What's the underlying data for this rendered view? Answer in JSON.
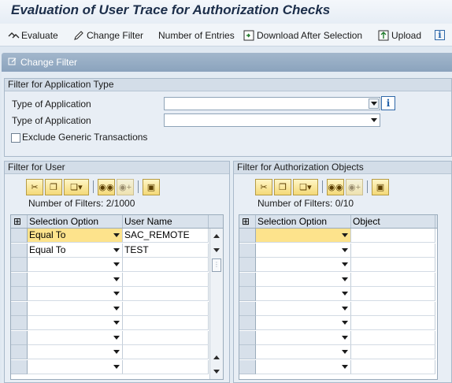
{
  "window": {
    "title": "Evaluation of User Trace for Authorization Checks"
  },
  "toolbar": {
    "evaluate": "Evaluate",
    "change_filter": "Change Filter",
    "number_of_entries": "Number of Entries",
    "download_after_selection": "Download After Selection",
    "upload": "Upload",
    "info_icon": "info-icon"
  },
  "panel": {
    "title": "Change Filter"
  },
  "app_filter": {
    "heading": "Filter for Application Type",
    "type1_label": "Type of Application",
    "type1_value": "",
    "type2_label": "Type of Application",
    "type2_value": "",
    "exclude_label": "Exclude Generic Transactions",
    "exclude_checked": false
  },
  "user_filter": {
    "heading": "Filter for User",
    "count_text": "Number of Filters: 2/1000",
    "columns": [
      "Selection Option",
      "User Name"
    ],
    "rows": [
      {
        "option": "Equal To",
        "value": "SAC_REMOTE"
      },
      {
        "option": "Equal To",
        "value": "TEST"
      },
      {
        "option": "",
        "value": ""
      },
      {
        "option": "",
        "value": ""
      },
      {
        "option": "",
        "value": ""
      },
      {
        "option": "",
        "value": ""
      },
      {
        "option": "",
        "value": ""
      },
      {
        "option": "",
        "value": ""
      },
      {
        "option": "",
        "value": ""
      },
      {
        "option": "",
        "value": ""
      }
    ]
  },
  "object_filter": {
    "heading": "Filter for Authorization Objects",
    "count_text": "Number of Filters: 0/10",
    "columns": [
      "Selection Option",
      "Object"
    ],
    "rows": [
      {
        "option": "",
        "value": ""
      },
      {
        "option": "",
        "value": ""
      },
      {
        "option": "",
        "value": ""
      },
      {
        "option": "",
        "value": ""
      },
      {
        "option": "",
        "value": ""
      },
      {
        "option": "",
        "value": ""
      },
      {
        "option": "",
        "value": ""
      },
      {
        "option": "",
        "value": ""
      },
      {
        "option": "",
        "value": ""
      },
      {
        "option": "",
        "value": ""
      }
    ]
  },
  "colors": {
    "selected_cell": "#fde38c",
    "panel_header": "#8ba3bd",
    "title_text": "#1c2e4a"
  }
}
